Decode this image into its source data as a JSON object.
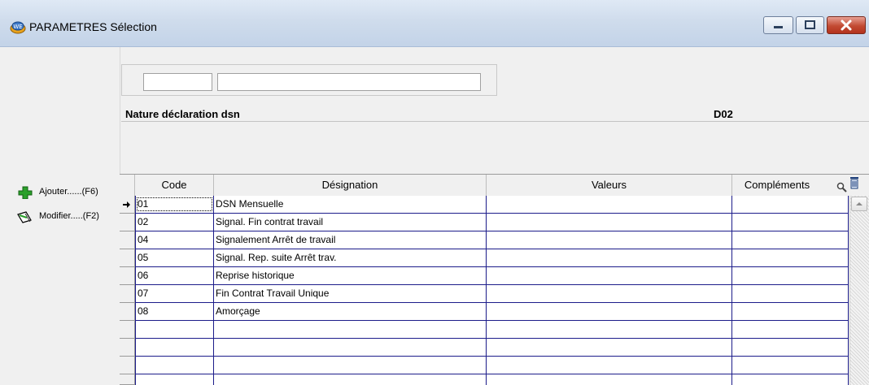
{
  "window": {
    "title": "PARAMETRES Sélection",
    "close_color": "#c24a33"
  },
  "sidebar": {
    "items": [
      {
        "label": "Ajouter......(F6)",
        "icon": "plus-icon"
      },
      {
        "label": "Modifier.....(F2)",
        "icon": "edit-icon"
      }
    ]
  },
  "filter": {
    "code_value": "",
    "designation_value": ""
  },
  "section": {
    "label": "Nature déclaration dsn",
    "code": "D02"
  },
  "grid": {
    "columns": [
      "Code",
      "Désignation",
      "Valeurs",
      "Compléments"
    ],
    "header_icons": [
      "search-icon",
      "delete-icon"
    ],
    "rows": [
      {
        "code": "01",
        "designation": "DSN Mensuelle",
        "valeurs": "",
        "complements": ""
      },
      {
        "code": "02",
        "designation": "Signal. Fin contrat travail",
        "valeurs": "",
        "complements": ""
      },
      {
        "code": "04",
        "designation": "Signalement Arrêt de travail",
        "valeurs": "",
        "complements": ""
      },
      {
        "code": "05",
        "designation": "Signal. Rep. suite Arrêt trav.",
        "valeurs": "",
        "complements": ""
      },
      {
        "code": "06",
        "designation": "Reprise historique",
        "valeurs": "",
        "complements": ""
      },
      {
        "code": "07",
        "designation": "Fin Contrat Travail Unique",
        "valeurs": "",
        "complements": ""
      },
      {
        "code": "08",
        "designation": "Amorçage",
        "valeurs": "",
        "complements": ""
      },
      {
        "code": "",
        "designation": "",
        "valeurs": "",
        "complements": ""
      },
      {
        "code": "",
        "designation": "",
        "valeurs": "",
        "complements": ""
      },
      {
        "code": "",
        "designation": "",
        "valeurs": "",
        "complements": ""
      },
      {
        "code": "",
        "designation": "",
        "valeurs": "",
        "complements": ""
      }
    ],
    "grid_line_color": "#1c1c8a"
  }
}
